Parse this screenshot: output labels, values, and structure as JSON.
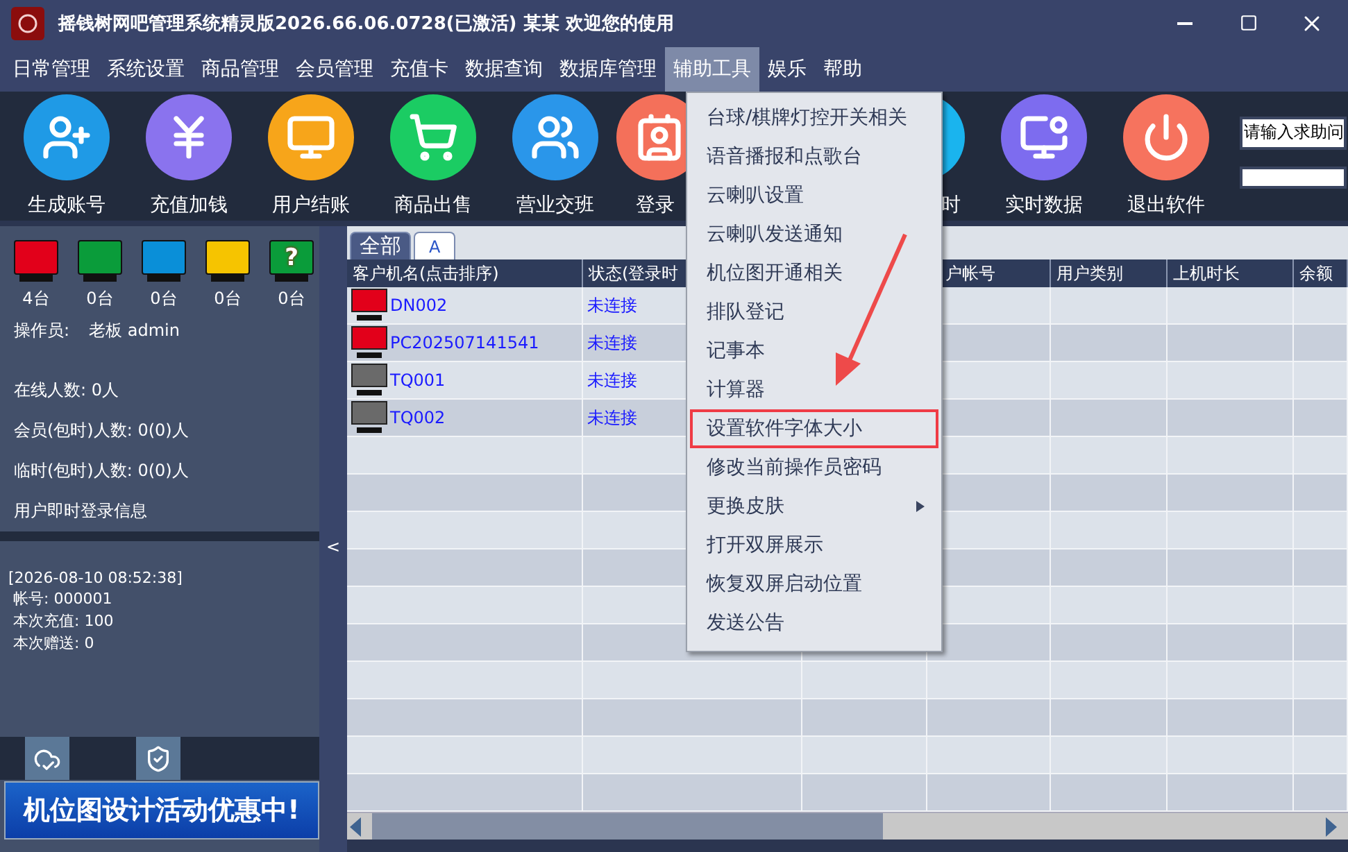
{
  "window": {
    "title": "摇钱树网吧管理系统精灵版2026.66.06.0728(已激活)  某某 欢迎您的使用"
  },
  "menu_bar": [
    {
      "label": "日常管理",
      "selected": false
    },
    {
      "label": "系统设置",
      "selected": false
    },
    {
      "label": "商品管理",
      "selected": false
    },
    {
      "label": "会员管理",
      "selected": false
    },
    {
      "label": "充值卡",
      "selected": false
    },
    {
      "label": "数据查询",
      "selected": false
    },
    {
      "label": "数据库管理",
      "selected": false
    },
    {
      "label": "辅助工具",
      "selected": true
    },
    {
      "label": "娱乐",
      "selected": false
    },
    {
      "label": "帮助",
      "selected": false
    }
  ],
  "toolbar": [
    {
      "label": "生成账号",
      "kind": "add-user",
      "color": "#1f9ae6"
    },
    {
      "label": "充值加钱",
      "kind": "yen",
      "color": "#8a73ee"
    },
    {
      "label": "用户结账",
      "kind": "monitor-yen",
      "color": "#f7a51a"
    },
    {
      "label": "商品出售",
      "kind": "cart",
      "color": "#1bcc63"
    },
    {
      "label": "营业交班",
      "kind": "users",
      "color": "#2a96ea"
    },
    {
      "label": "登录",
      "kind": "id-card",
      "color": "#f4705a"
    },
    {
      "label": "时",
      "kind": "blank",
      "color": "#1ab4ee"
    },
    {
      "label": "实时数据",
      "kind": "monitor-clock",
      "color": "#7d6cef"
    },
    {
      "label": "退出软件",
      "kind": "power",
      "color": "#f6735e"
    }
  ],
  "help_search": {
    "value": "请输入求助问"
  },
  "left_panel": {
    "monitors": [
      {
        "color": "#e2001a",
        "count": "4台"
      },
      {
        "color": "#0a9c3a",
        "count": "0台"
      },
      {
        "color": "#0a8fd8",
        "count": "0台"
      },
      {
        "color": "#f6c400",
        "count": "0台"
      },
      {
        "color": "#0a9c3a",
        "count": "0台",
        "symbol": "?"
      }
    ],
    "operator_label": "操作员:",
    "operator": "老板 admin",
    "stats": [
      "在线人数: 0人",
      "会员(包时)人数: 0(0)人",
      "临时(包时)人数: 0(0)人"
    ],
    "login_info": "用户即时登录信息",
    "log": [
      "[2026-08-10 08:52:38]",
      " 帐号: 000001",
      " 本次充值: 100",
      " 本次赠送: 0"
    ],
    "banner": "机位图设计活动优惠中!"
  },
  "splitter": "<",
  "tabs": [
    {
      "label": "全部",
      "selected": true
    },
    {
      "label": "A",
      "selected": false
    }
  ],
  "table": {
    "columns": [
      {
        "label": "客户机名(点击排序)"
      },
      {
        "label": "状态(登录时"
      },
      {},
      {
        "label": "户帐号"
      },
      {
        "label": "用户类别"
      },
      {
        "label": "上机时长"
      },
      {
        "label": "余额"
      }
    ],
    "rows": [
      {
        "name": "DN002",
        "status": "未连接",
        "color": "#e2001a"
      },
      {
        "name": "PC202507141541",
        "status": "未连接",
        "color": "#e2001a"
      },
      {
        "name": "TQ001",
        "status": "未连接",
        "color": "#6a6a6a"
      },
      {
        "name": "TQ002",
        "status": "未连接",
        "color": "#6a6a6a"
      }
    ]
  },
  "context_menu": {
    "items": [
      {
        "label": "台球/棋牌灯控开关相关",
        "submenu": false,
        "highlighted": false
      },
      {
        "label": "语音播报和点歌台",
        "submenu": false,
        "highlighted": false
      },
      {
        "label": "云喇叭设置",
        "submenu": false,
        "highlighted": false
      },
      {
        "label": "云喇叭发送通知",
        "submenu": false,
        "highlighted": false
      },
      {
        "label": "机位图开通相关",
        "submenu": false,
        "highlighted": false
      },
      {
        "label": "排队登记",
        "submenu": false,
        "highlighted": false
      },
      {
        "label": "记事本",
        "submenu": false,
        "highlighted": false
      },
      {
        "label": "计算器",
        "submenu": false,
        "highlighted": false
      },
      {
        "label": "设置软件字体大小",
        "submenu": false,
        "highlighted": true
      },
      {
        "label": "修改当前操作员密码",
        "submenu": false,
        "highlighted": false
      },
      {
        "label": "更换皮肤",
        "submenu": true,
        "highlighted": false
      },
      {
        "label": "打开双屏展示",
        "submenu": false,
        "highlighted": false
      },
      {
        "label": "恢复双屏启动位置",
        "submenu": false,
        "highlighted": false
      },
      {
        "label": "发送公告",
        "submenu": false,
        "highlighted": false
      }
    ]
  }
}
